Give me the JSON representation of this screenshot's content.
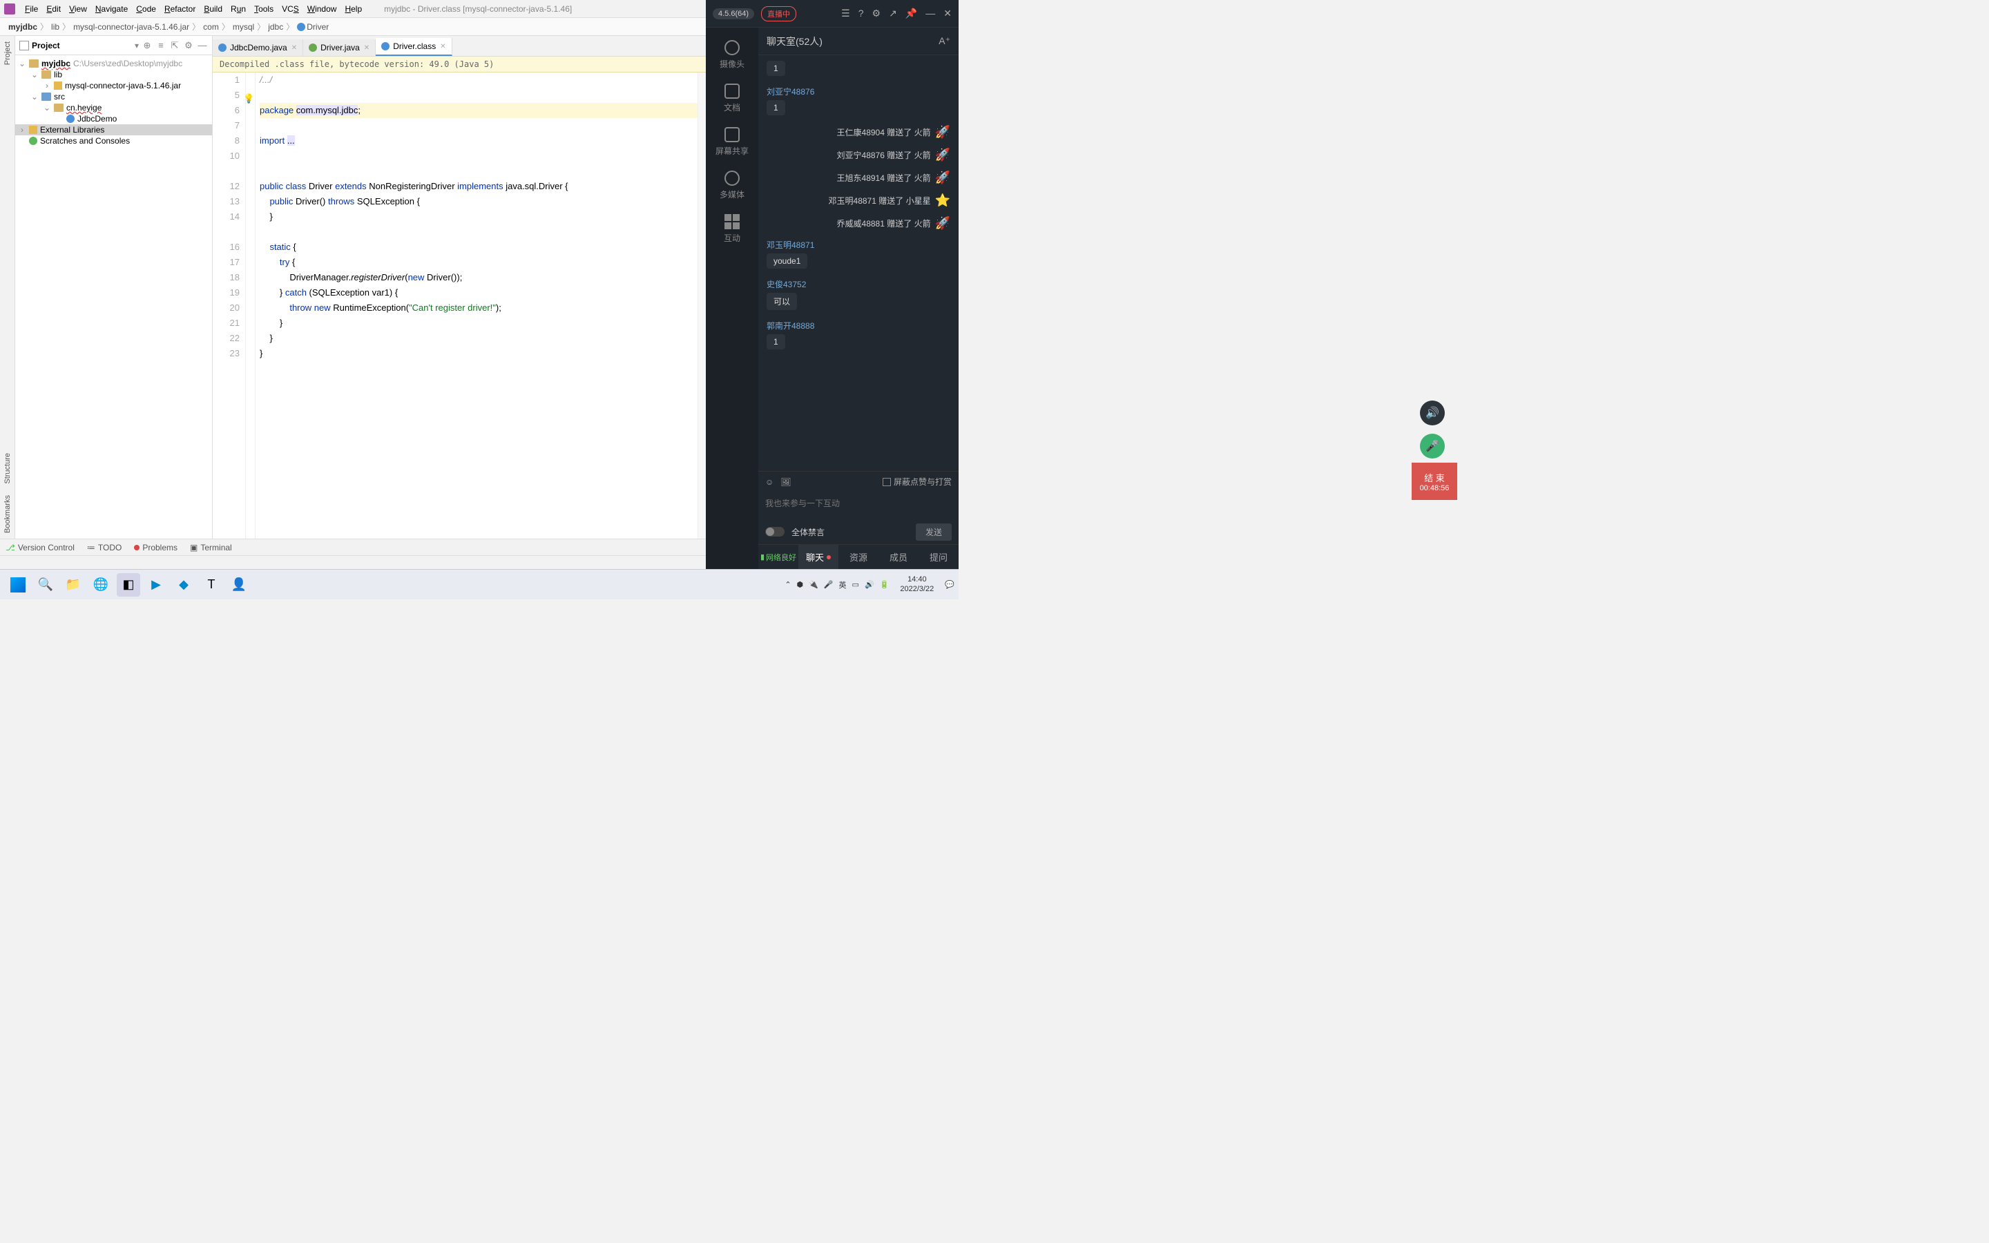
{
  "menu": {
    "file": "File",
    "edit": "Edit",
    "view": "View",
    "navigate": "Navigate",
    "code": "Code",
    "refactor": "Refactor",
    "build": "Build",
    "run": "Run",
    "tools": "Tools",
    "vcs": "VCS",
    "window": "Window",
    "help": "Help",
    "title": "myjdbc - Driver.class [mysql-connector-java-5.1.46]"
  },
  "breadcrumb": [
    "myjdbc",
    "lib",
    "mysql-connector-java-5.1.46.jar",
    "com",
    "mysql",
    "jdbc",
    "Driver"
  ],
  "leftTabs": {
    "project": "Project",
    "structure": "Structure",
    "bookmarks": "Bookmarks"
  },
  "panel": {
    "title": "Project"
  },
  "tree": {
    "root": "myjdbc",
    "rootHint": "C:\\Users\\zed\\Desktop\\myjdbc",
    "lib": "lib",
    "jar": "mysql-connector-java-5.1.46.jar",
    "src": "src",
    "pkg": "cn.heyige",
    "cls": "JdbcDemo",
    "ext": "External Libraries",
    "scratch": "Scratches and Consoles"
  },
  "tabs": [
    {
      "label": "JdbcDemo.java",
      "icon": "c"
    },
    {
      "label": "Driver.java",
      "icon": "i"
    },
    {
      "label": "Driver.class",
      "icon": "c",
      "active": true
    }
  ],
  "banner": "Decompiled .class file, bytecode version: 49.0 (Java 5)",
  "gutter": [
    1,
    5,
    6,
    7,
    8,
    10,
    12,
    13,
    14,
    16,
    17,
    18,
    19,
    20,
    21,
    22,
    23
  ],
  "code": {
    "l1": "/.../",
    "l6a": "package ",
    "l6b": "com.mysql.jdbc",
    "l6c": ";",
    "l8a": "import ",
    "l8b": "...",
    "l12a": "public ",
    "l12b": "class ",
    "l12c": "Driver ",
    "l12d": "extends ",
    "l12e": "NonRegisteringDriver ",
    "l12f": "implements ",
    "l12g": "java.sql.Driver {",
    "l13a": "    public ",
    "l13b": "Driver",
    "l13c": "() ",
    "l13d": "throws ",
    "l13e": "SQLException {",
    "l14": "    }",
    "l16a": "    static ",
    "l16b": "{",
    "l17a": "        try ",
    "l17b": "{",
    "l18a": "            DriverManager.",
    "l18b": "registerDriver",
    "l18c": "(",
    "l18d": "new ",
    "l18e": "Driver());",
    "l19a": "        } ",
    "l19b": "catch ",
    "l19c": "(SQLException var1) {",
    "l20a": "            throw ",
    "l20b": "new ",
    "l20c": "RuntimeException(",
    "l20d": "\"Can't register driver!\"",
    "l20e": ");",
    "l21": "        }",
    "l22": "    }",
    "l23": "}"
  },
  "bottom": {
    "vcs": "Version Control",
    "todo": "TODO",
    "problems": "Problems",
    "terminal": "Terminal"
  },
  "live": {
    "version": "4.5.6(64)",
    "status": "直播中",
    "side": {
      "cam": "摄像头",
      "doc": "文档",
      "screen": "屏幕共享",
      "media": "多媒体",
      "interact": "互动"
    },
    "chatTitle": "聊天室(52人)",
    "messages": [
      {
        "type": "bubble",
        "user": "",
        "text": "1"
      },
      {
        "type": "name",
        "user": "刘亚宁48876"
      },
      {
        "type": "bubble",
        "text": "1"
      },
      {
        "type": "gift",
        "text": "王仁康48904 赠送了 火箭",
        "icon": "🚀"
      },
      {
        "type": "gift",
        "text": "刘亚宁48876 赠送了 火箭",
        "icon": "🚀"
      },
      {
        "type": "gift",
        "text": "王旭东48914 赠送了 火箭",
        "icon": "🚀"
      },
      {
        "type": "gift",
        "text": "邓玉明48871 赠送了 小星星",
        "icon": "⭐"
      },
      {
        "type": "gift",
        "text": "乔威威48881 赠送了 火箭",
        "icon": "🚀"
      },
      {
        "type": "name",
        "user": "邓玉明48871"
      },
      {
        "type": "bubble",
        "text": "youde1"
      },
      {
        "type": "name",
        "user": "史俊43752"
      },
      {
        "type": "bubble",
        "text": "可以"
      },
      {
        "type": "name",
        "user": "郭南开48888"
      },
      {
        "type": "bubble",
        "text": "1"
      }
    ],
    "shield": "屏蔽点赞与打赏",
    "placeholder": "我也来参与一下互动",
    "mute": "全体禁言",
    "send": "发送",
    "end": "结 束",
    "timer": "00:48:56",
    "net": "网络良好",
    "tabs": {
      "chat": "聊天",
      "res": "资源",
      "member": "成员",
      "qa": "提问"
    }
  },
  "taskbar": {
    "time": "14:40",
    "date": "2022/3/22",
    "ime": "英"
  }
}
